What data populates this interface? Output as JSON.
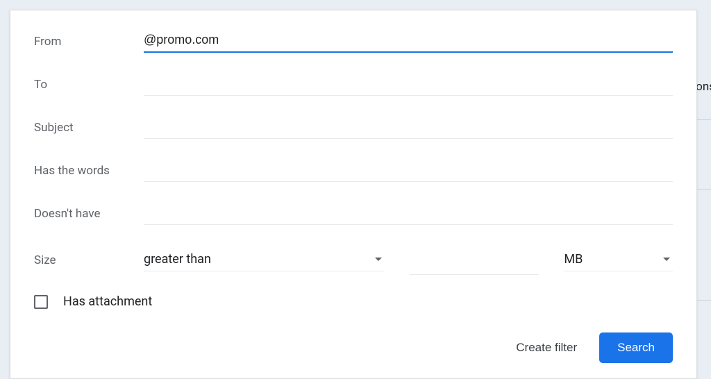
{
  "labels": {
    "from": "From",
    "to": "To",
    "subject": "Subject",
    "has_words": "Has the words",
    "doesnt_have": "Doesn't have",
    "size": "Size",
    "has_attachment": "Has attachment"
  },
  "values": {
    "from": "@promo.com",
    "to": "",
    "subject": "",
    "has_words": "",
    "doesnt_have": "",
    "size_comparator": "greater than",
    "size_amount": "",
    "size_unit": "MB",
    "has_attachment_checked": false
  },
  "actions": {
    "create_filter": "Create filter",
    "search": "Search"
  },
  "background": {
    "partial_text": "ons"
  }
}
